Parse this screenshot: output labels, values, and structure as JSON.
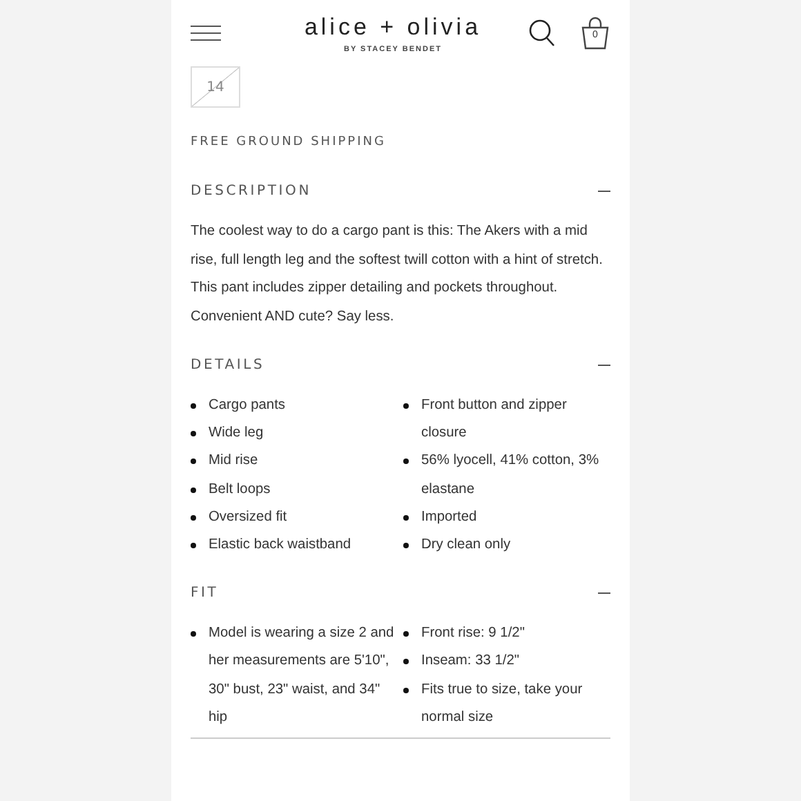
{
  "header": {
    "logo": "alice + olivia",
    "tagline": "BY STACEY BENDET",
    "cart_count": "0"
  },
  "sizes": [
    {
      "label": "14",
      "available": false
    }
  ],
  "shipping": "FREE GROUND SHIPPING",
  "sections": [
    {
      "kind": "text",
      "title": "DESCRIPTION",
      "expanded": true,
      "body": "The coolest way to do a cargo pant is this: The Akers with a mid rise, full length leg and the softest twill cotton with a hint of stretch. This pant includes zipper detailing and pockets throughout. Convenient AND cute? Say less."
    },
    {
      "kind": "list",
      "title": "DETAILS",
      "expanded": true,
      "columns": [
        [
          "Cargo pants",
          "Wide leg",
          "Mid rise",
          "Belt loops",
          "Oversized fit",
          "Elastic back waistband"
        ],
        [
          "Front button and zipper closure",
          "56% lyocell, 41% cotton, 3% elastane",
          "Imported",
          "Dry clean only"
        ]
      ]
    },
    {
      "kind": "list",
      "title": "FIT",
      "expanded": true,
      "columns": [
        [
          "Model is wearing a size 2 and her measurements are 5'10\", 30\" bust, 23\" waist, and 34\" hip"
        ],
        [
          "Front rise: 9 1/2\"",
          "Inseam: 33 1/2\"",
          "Fits true to size, take your normal size"
        ]
      ]
    }
  ]
}
